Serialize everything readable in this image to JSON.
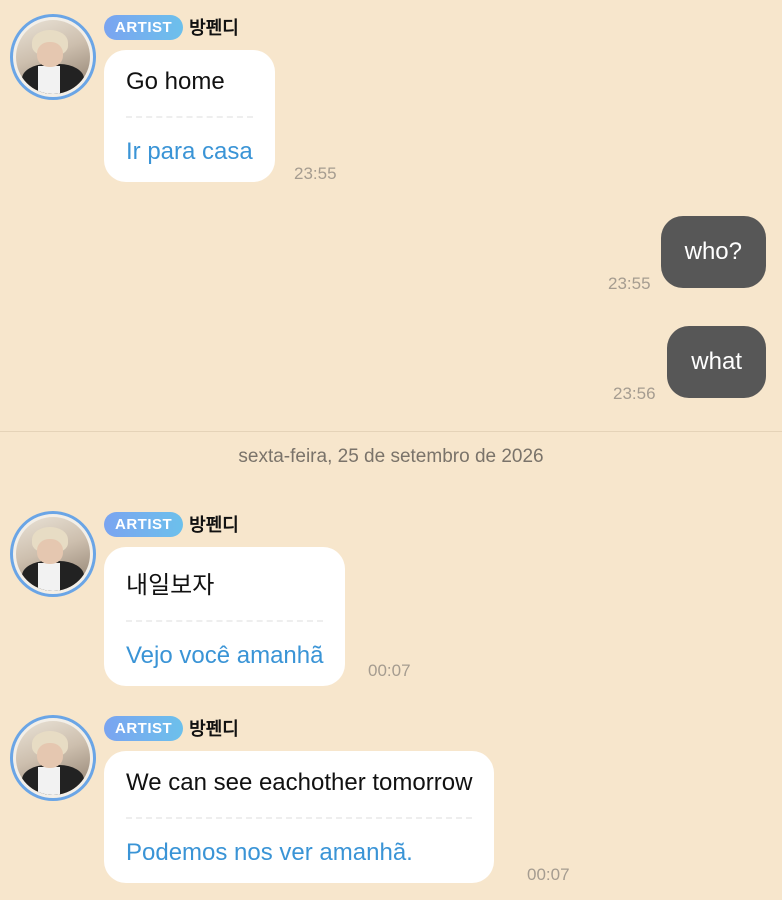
{
  "messages": [
    {
      "badge": "ARTIST",
      "sender": "방펜디",
      "original": "Go home",
      "translation": "Ir para casa",
      "time": "23:55"
    },
    {
      "outgoing_text": "who?",
      "time": "23:55"
    },
    {
      "outgoing_text": "what",
      "time": "23:56"
    },
    {
      "badge": "ARTIST",
      "sender": "방펜디",
      "original": "내일보자",
      "translation": "Vejo você amanhã",
      "time": "00:07"
    },
    {
      "badge": "ARTIST",
      "sender": "방펜디",
      "original": "We can see eachother tomorrow",
      "translation": "Podemos nos ver amanhã.",
      "time": "00:07"
    }
  ],
  "date_separator": "sexta-feira, 25 de setembro de 2026",
  "colors": {
    "background": "#f7e6cc",
    "outgoing_bubble": "#575757",
    "translation_text": "#3a94d6",
    "badge_gradient_start": "#7aa4f0",
    "badge_gradient_end": "#6cc0ec"
  }
}
